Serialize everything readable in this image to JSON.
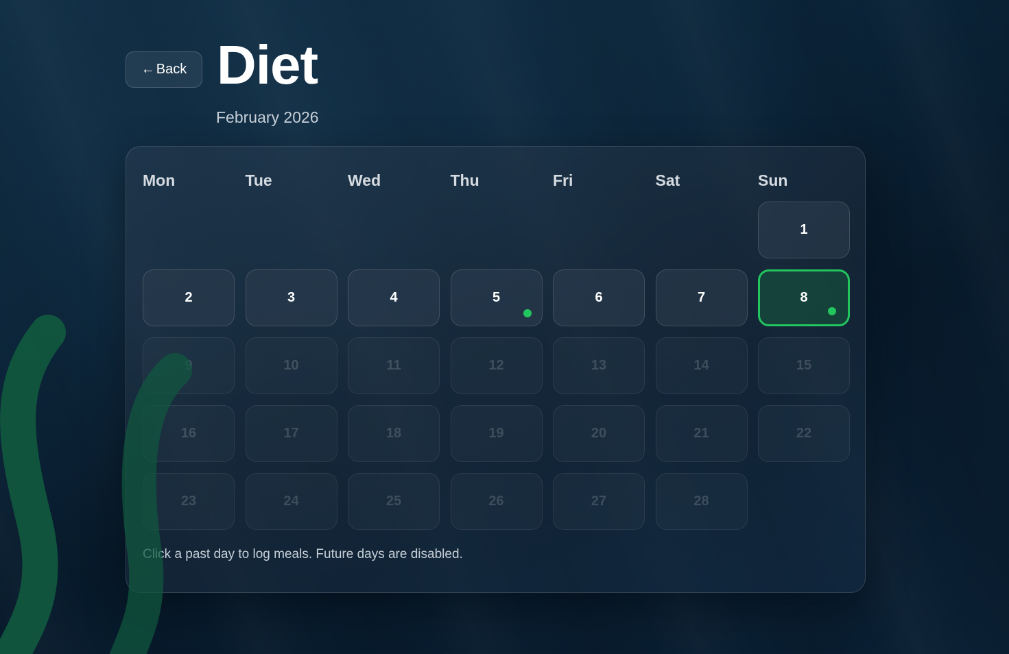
{
  "header": {
    "back_label": "Back",
    "back_arrow": "←",
    "title": "Diet",
    "subtitle": "February 2026"
  },
  "calendar": {
    "weekdays": [
      "Mon",
      "Tue",
      "Wed",
      "Thu",
      "Fri",
      "Sat",
      "Sun"
    ],
    "leading_blank_days": 6,
    "days": [
      {
        "label": "1",
        "state": "past",
        "logged": false
      },
      {
        "label": "2",
        "state": "past",
        "logged": false
      },
      {
        "label": "3",
        "state": "past",
        "logged": false
      },
      {
        "label": "4",
        "state": "past",
        "logged": false
      },
      {
        "label": "5",
        "state": "past",
        "logged": true
      },
      {
        "label": "6",
        "state": "past",
        "logged": false
      },
      {
        "label": "7",
        "state": "past",
        "logged": false
      },
      {
        "label": "8",
        "state": "today",
        "logged": true
      },
      {
        "label": "9",
        "state": "future",
        "logged": false
      },
      {
        "label": "10",
        "state": "future",
        "logged": false
      },
      {
        "label": "11",
        "state": "future",
        "logged": false
      },
      {
        "label": "12",
        "state": "future",
        "logged": false
      },
      {
        "label": "13",
        "state": "future",
        "logged": false
      },
      {
        "label": "14",
        "state": "future",
        "logged": false
      },
      {
        "label": "15",
        "state": "future",
        "logged": false
      },
      {
        "label": "16",
        "state": "future",
        "logged": false
      },
      {
        "label": "17",
        "state": "future",
        "logged": false
      },
      {
        "label": "18",
        "state": "future",
        "logged": false
      },
      {
        "label": "19",
        "state": "future",
        "logged": false
      },
      {
        "label": "20",
        "state": "future",
        "logged": false
      },
      {
        "label": "21",
        "state": "future",
        "logged": false
      },
      {
        "label": "22",
        "state": "future",
        "logged": false
      },
      {
        "label": "23",
        "state": "future",
        "logged": false
      },
      {
        "label": "24",
        "state": "future",
        "logged": false
      },
      {
        "label": "25",
        "state": "future",
        "logged": false
      },
      {
        "label": "26",
        "state": "future",
        "logged": false
      },
      {
        "label": "27",
        "state": "future",
        "logged": false
      },
      {
        "label": "28",
        "state": "future",
        "logged": false
      }
    ],
    "hint": "Click a past day to log meals. Future days are disabled."
  },
  "colors": {
    "accent": "#22c55e",
    "background": "#0a2236",
    "card": "#1e2d3e"
  }
}
